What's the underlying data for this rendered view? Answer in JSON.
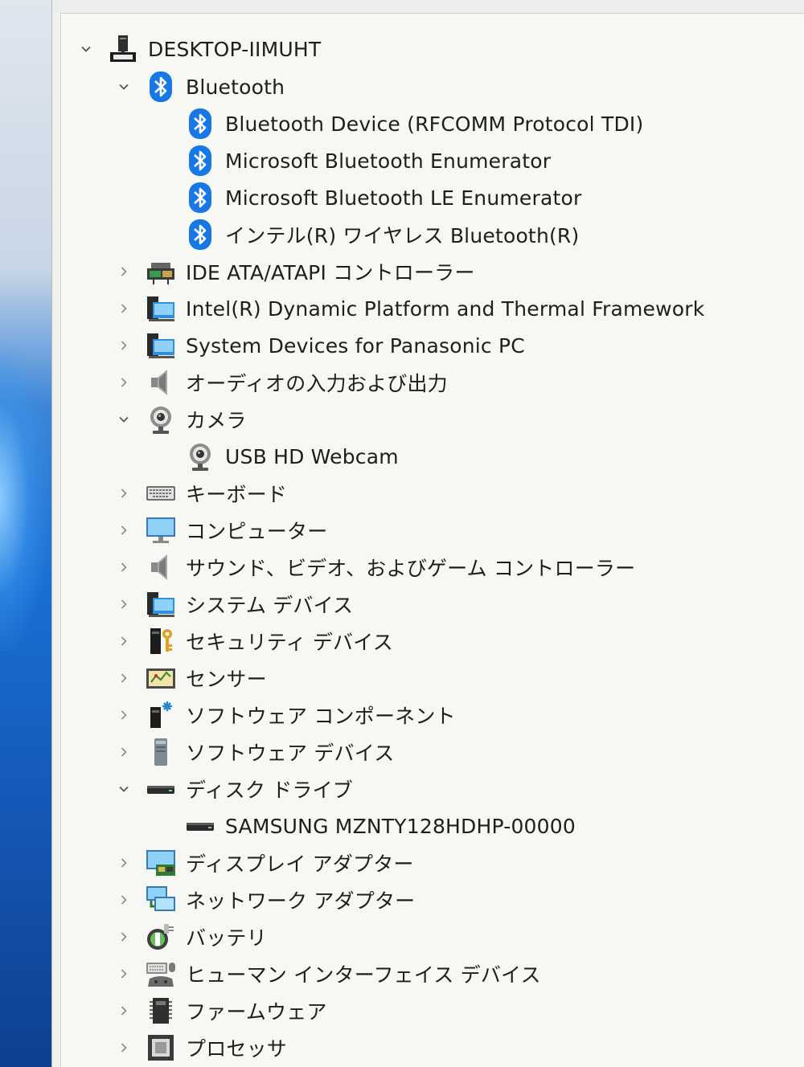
{
  "tree": {
    "root": {
      "label": "DESKTOP-IIMUHT",
      "icon": "computer-tower-icon",
      "expanded": true
    },
    "items": [
      {
        "label": "Bluetooth",
        "icon": "bluetooth-icon",
        "level": 1,
        "state": "expanded"
      },
      {
        "label": "Bluetooth Device (RFCOMM Protocol TDI)",
        "icon": "bluetooth-icon",
        "level": 2,
        "state": "leaf"
      },
      {
        "label": "Microsoft Bluetooth Enumerator",
        "icon": "bluetooth-icon",
        "level": 2,
        "state": "leaf"
      },
      {
        "label": "Microsoft Bluetooth LE Enumerator",
        "icon": "bluetooth-icon",
        "level": 2,
        "state": "leaf"
      },
      {
        "label": "インテル(R) ワイヤレス Bluetooth(R)",
        "icon": "bluetooth-icon",
        "level": 2,
        "state": "leaf"
      },
      {
        "label": "IDE ATA/ATAPI コントローラー",
        "icon": "ide-controller-icon",
        "level": 1,
        "state": "collapsed"
      },
      {
        "label": "Intel(R) Dynamic Platform and Thermal Framework",
        "icon": "system-folder-icon",
        "level": 1,
        "state": "collapsed"
      },
      {
        "label": "System Devices for Panasonic PC",
        "icon": "system-folder-icon",
        "level": 1,
        "state": "collapsed"
      },
      {
        "label": "オーディオの入力および出力",
        "icon": "speaker-icon",
        "level": 1,
        "state": "collapsed"
      },
      {
        "label": "カメラ",
        "icon": "webcam-icon",
        "level": 1,
        "state": "expanded"
      },
      {
        "label": "USB HD Webcam",
        "icon": "webcam-icon",
        "level": 2,
        "state": "leaf"
      },
      {
        "label": "キーボード",
        "icon": "keyboard-icon",
        "level": 1,
        "state": "collapsed"
      },
      {
        "label": "コンピューター",
        "icon": "monitor-icon",
        "level": 1,
        "state": "collapsed"
      },
      {
        "label": "サウンド、ビデオ、およびゲーム コントローラー",
        "icon": "speaker-icon",
        "level": 1,
        "state": "collapsed"
      },
      {
        "label": "システム デバイス",
        "icon": "system-folder-icon",
        "level": 1,
        "state": "collapsed"
      },
      {
        "label": "セキュリティ デバイス",
        "icon": "security-key-icon",
        "level": 1,
        "state": "collapsed"
      },
      {
        "label": "センサー",
        "icon": "sensor-icon",
        "level": 1,
        "state": "collapsed"
      },
      {
        "label": "ソフトウェア コンポーネント",
        "icon": "software-component-icon",
        "level": 1,
        "state": "collapsed"
      },
      {
        "label": "ソフトウェア デバイス",
        "icon": "software-device-icon",
        "level": 1,
        "state": "collapsed"
      },
      {
        "label": "ディスク ドライブ",
        "icon": "disk-drive-icon",
        "level": 1,
        "state": "expanded"
      },
      {
        "label": "SAMSUNG MZNTY128HDHP-00000",
        "icon": "disk-drive-icon",
        "level": 2,
        "state": "leaf"
      },
      {
        "label": "ディスプレイ アダプター",
        "icon": "display-adapter-icon",
        "level": 1,
        "state": "collapsed"
      },
      {
        "label": "ネットワーク アダプター",
        "icon": "network-adapter-icon",
        "level": 1,
        "state": "collapsed"
      },
      {
        "label": "バッテリ",
        "icon": "battery-icon",
        "level": 1,
        "state": "collapsed"
      },
      {
        "label": "ヒューマン インターフェイス デバイス",
        "icon": "hid-icon",
        "level": 1,
        "state": "collapsed"
      },
      {
        "label": "ファームウェア",
        "icon": "firmware-chip-icon",
        "level": 1,
        "state": "collapsed"
      },
      {
        "label": "プロセッサ",
        "icon": "processor-icon",
        "level": 1,
        "state": "collapsed"
      }
    ]
  }
}
